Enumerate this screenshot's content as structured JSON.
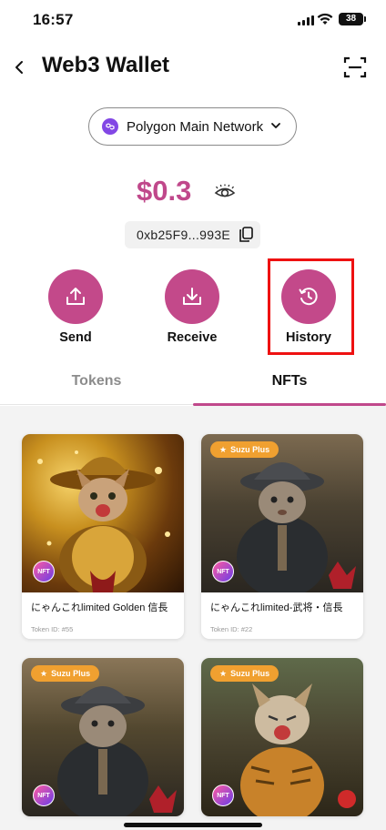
{
  "status": {
    "time": "16:57",
    "battery": "38"
  },
  "header": {
    "title": "Web3 Wallet"
  },
  "network": {
    "label": "Polygon Main Network"
  },
  "balance": {
    "amount": "$0.3",
    "address": "0xb25F9...993E"
  },
  "actions": [
    {
      "label": "Send"
    },
    {
      "label": "Receive"
    },
    {
      "label": "History"
    }
  ],
  "tabs": [
    {
      "label": "Tokens"
    },
    {
      "label": "NFTs"
    }
  ],
  "nfts": [
    {
      "name": "にゃんこれlimited Golden 信長",
      "token_id": "Token ID: #55",
      "badge": "",
      "nft_label": "NFT"
    },
    {
      "name": "にゃんこれlimited-武将・信長",
      "token_id": "Token ID: #22",
      "badge": "Suzu Plus",
      "nft_label": "NFT"
    },
    {
      "name": "",
      "token_id": "",
      "badge": "Suzu Plus",
      "nft_label": "NFT"
    },
    {
      "name": "",
      "token_id": "",
      "badge": "Suzu Plus",
      "nft_label": "NFT"
    }
  ],
  "colors": {
    "accent": "#c0488b",
    "badge": "#f0a030",
    "highlight": "#ee1111"
  }
}
